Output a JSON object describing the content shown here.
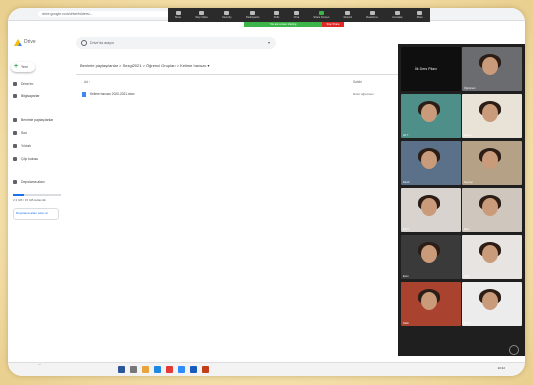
{
  "browser": {
    "url": "drive.google.com/drive/folders/..."
  },
  "zoom_toolbar": {
    "items": [
      "Mute",
      "Stop Video",
      "Security",
      "Participants",
      "Polls",
      "Chat",
      "Share Screen",
      "Record",
      "Reactions",
      "Annotate",
      "More"
    ],
    "sharing_label": "You are screen sharing",
    "stop_share_label": "Stop Share"
  },
  "drive": {
    "app_name": "Drive",
    "search_placeholder": "Drive'da arayın",
    "new_button": "Yeni",
    "sidebar_items": [
      "Drive'ım",
      "Bilgisayarlar",
      "Benimle paylaşılanlar",
      "Son",
      "Yıldızlı",
      "Çöp kutusu"
    ],
    "storage_label": "Depolama alanı",
    "storage_text": "2,3 GB / 15 GB kullanıldı",
    "buy_storage": "Depolama alanı satın al",
    "breadcrumb": "Benimle paylaşılanlar  >  Sezgi2021  >  Öğrenci Grupları  >  Kelime havuzu ▾",
    "col_name": "Ad ↑",
    "col_owner": "Sahibi",
    "files": [
      {
        "name": "Kelime havuzu 2020-2021.docx",
        "owner": "ilknur öğretmen"
      }
    ]
  },
  "gallery": {
    "dark_tile_label": "İlk Ders Pilavı",
    "participants": [
      "Öğretmen",
      "Ali Y.",
      "Esra K.",
      "Deniz",
      "Zeynep",
      "Elif T.",
      "Mert",
      "Eren",
      "Ayşe",
      "Selin",
      "Burak",
      "Nisa",
      "Kaan"
    ]
  },
  "taskbar": {
    "clock": "10:42"
  },
  "watermark": "..."
}
